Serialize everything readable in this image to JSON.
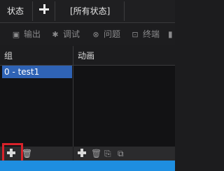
{
  "tabs": {
    "status_label": "状态",
    "add_symbol": "+",
    "all_status_label": "[所有状态]"
  },
  "toolbar": {
    "items": [
      {
        "label": "输出",
        "icon": "output-icon"
      },
      {
        "label": "调试",
        "icon": "bug-icon"
      },
      {
        "label": "问题",
        "icon": "error-icon"
      },
      {
        "label": "终端",
        "icon": "terminal-icon"
      }
    ]
  },
  "panels": {
    "left_header": "组",
    "right_header": "动画",
    "groups": [
      {
        "label": "0 - test1",
        "selected": true
      }
    ]
  },
  "colors": {
    "selected_row": "#2f63b5",
    "highlight_border": "#d8222a",
    "status_strip": "#1e8ee0"
  }
}
